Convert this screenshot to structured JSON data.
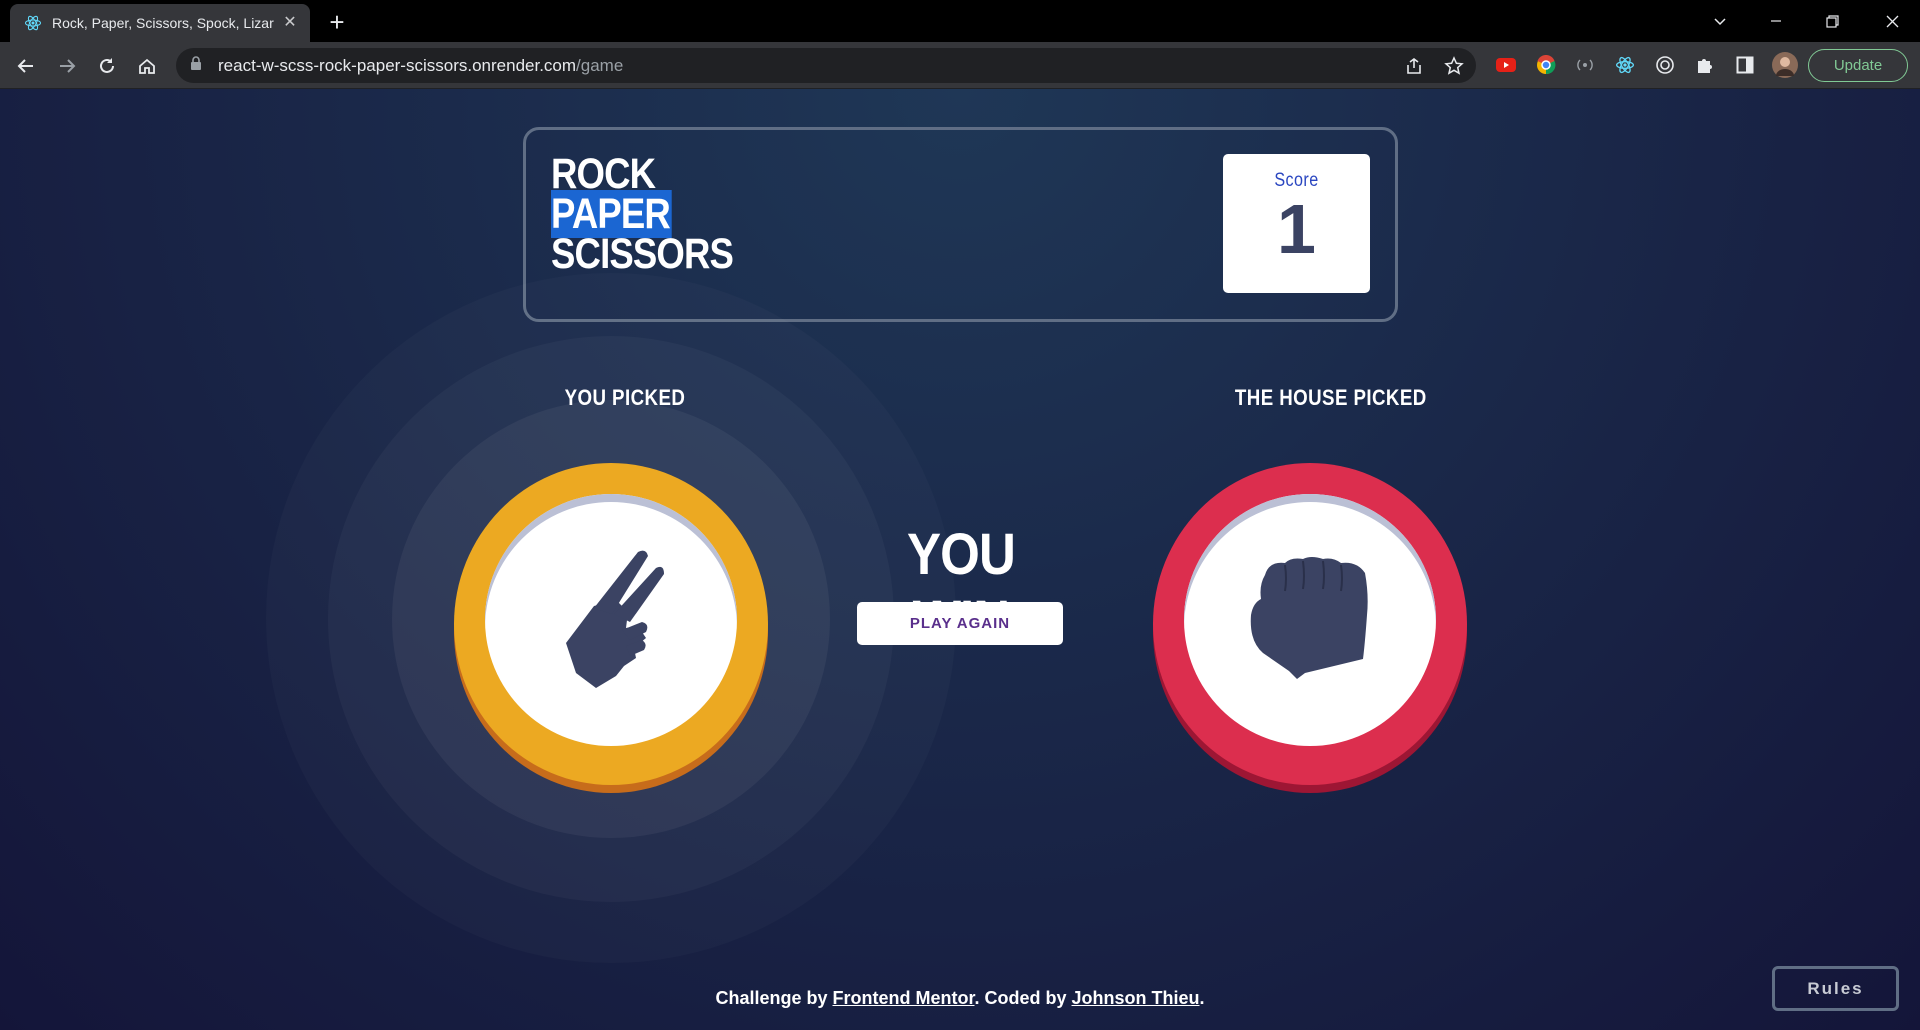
{
  "browser": {
    "tab_title": "Rock, Paper, Scissors, Spock, Lizar",
    "url_host": "react-w-scss-rock-paper-scissors.onrender.com",
    "url_path": "/game",
    "update_label": "Update"
  },
  "game": {
    "title_lines": [
      "ROCK",
      "PAPER",
      "SCISSORS"
    ],
    "score_label": "Score",
    "score_value": "1",
    "you_picked_label": "YOU PICKED",
    "house_picked_label": "THE HOUSE PICKED",
    "player_choice": "scissors",
    "house_choice": "rock",
    "result": "YOU WIN",
    "play_again_label": "PLAY AGAIN",
    "rules_label": "Rules"
  },
  "footer": {
    "prefix": "Challenge by ",
    "link1": "Frontend Mentor",
    "middle": ". Coded by ",
    "link2": "Johnson Thieu",
    "suffix": "."
  },
  "colors": {
    "scissors": "#eca922",
    "rock": "#dc2e4e",
    "icon": "#3b4363",
    "background": "#1f3756"
  }
}
